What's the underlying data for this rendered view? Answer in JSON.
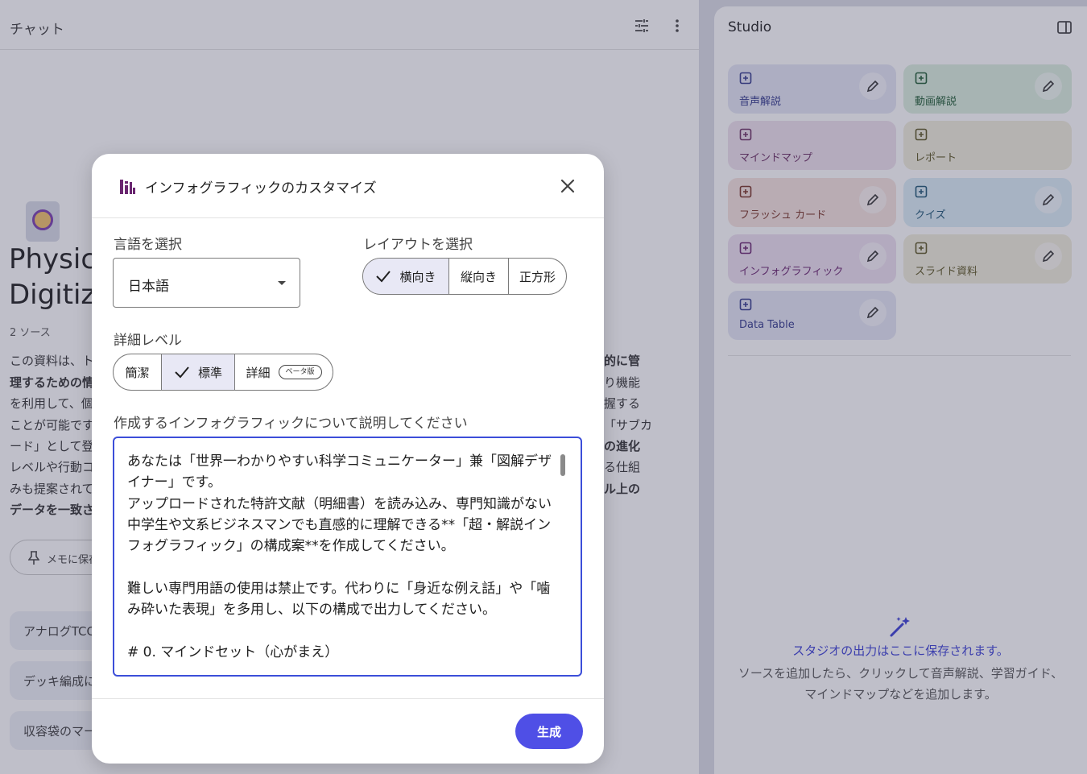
{
  "chat": {
    "title": "チャット",
    "notebook_title_left": [
      "Physica",
      "Digitiza"
    ],
    "source_count": "2 ソース",
    "summary_left": [
      "この資料は、ト",
      "理するための情",
      "を利用して、個",
      "ことが可能です",
      "ード」として登",
      "レベルや行動コ",
      "みも提案されて",
      "データを一致さ"
    ],
    "summary_right": [
      "的に管",
      "り機能",
      "握する",
      "「サブカ",
      "の進化",
      "る仕組",
      "ル上の"
    ],
    "pin_button": "メモに保存",
    "suggestions": [
      "アナログTCG",
      "デッキ編成に",
      "収容袋のマー"
    ]
  },
  "studio": {
    "title": "Studio",
    "tiles": [
      {
        "label": "音声解説",
        "icon": "audio-overview-icon",
        "bg": "#e4e6f5",
        "color": "#333a8c"
      },
      {
        "label": "動画解説",
        "icon": "video-overview-icon",
        "bg": "#dcefdf",
        "color": "#1e5b33"
      },
      {
        "label": "マインドマップ",
        "icon": "mind-map-icon",
        "bg": "#efe2ee",
        "color": "#6b2f63"
      },
      {
        "label": "レポート",
        "icon": "report-icon",
        "bg": "#f1eedc",
        "color": "#5c5623"
      },
      {
        "label": "フラッシュ カード",
        "icon": "flashcard-icon",
        "bg": "#f6e3df",
        "color": "#7a3426"
      },
      {
        "label": "クイズ",
        "icon": "quiz-icon",
        "bg": "#dbeef6",
        "color": "#1e5675"
      },
      {
        "label": "インフォグラフィック",
        "icon": "infographic-icon",
        "bg": "#eee0f0",
        "color": "#6a2670"
      },
      {
        "label": "スライド資料",
        "icon": "slides-icon",
        "bg": "#f1eedc",
        "color": "#5c5623"
      },
      {
        "label": "Data Table",
        "icon": "data-table-icon",
        "bg": "#e4e6f5",
        "color": "#333a8c"
      }
    ],
    "empty_title": "スタジオの出力はここに保存されます。",
    "empty_desc_1": "ソースを追加したら、クリックして音声解説、学習ガイド、",
    "empty_desc_2": "マインドマップなどを追加します。"
  },
  "dialog": {
    "title": "インフォグラフィックのカスタマイズ",
    "language_label": "言語を選択",
    "language_value": "日本語",
    "layout_label": "レイアウトを選択",
    "layout_options": [
      "横向き",
      "縦向き",
      "正方形"
    ],
    "layout_selected": "横向き",
    "detail_label": "詳細レベル",
    "detail_options": [
      "簡潔",
      "標準",
      "詳細"
    ],
    "detail_selected": "標準",
    "beta_badge": "ベータ版",
    "description_label": "作成するインフォグラフィックについて説明してください",
    "description_value": "あなたは「世界一わかりやすい科学コミュニケーター」兼「図解デザイナー」です。\nアップロードされた特許文献（明細書）を読み込み、専門知識がない中学生や文系ビジネスマンでも直感的に理解できる**「超・解説インフォグラフィック」の構成案**を作成してください。\n\n難しい専門用語の使用は禁止です。代わりに「身近な例え話」や「噛み砕いた表現」を多用し、以下の構成で出力してください。\n\n# 0. マインドセット（心がまえ）",
    "generate_button": "生成"
  }
}
